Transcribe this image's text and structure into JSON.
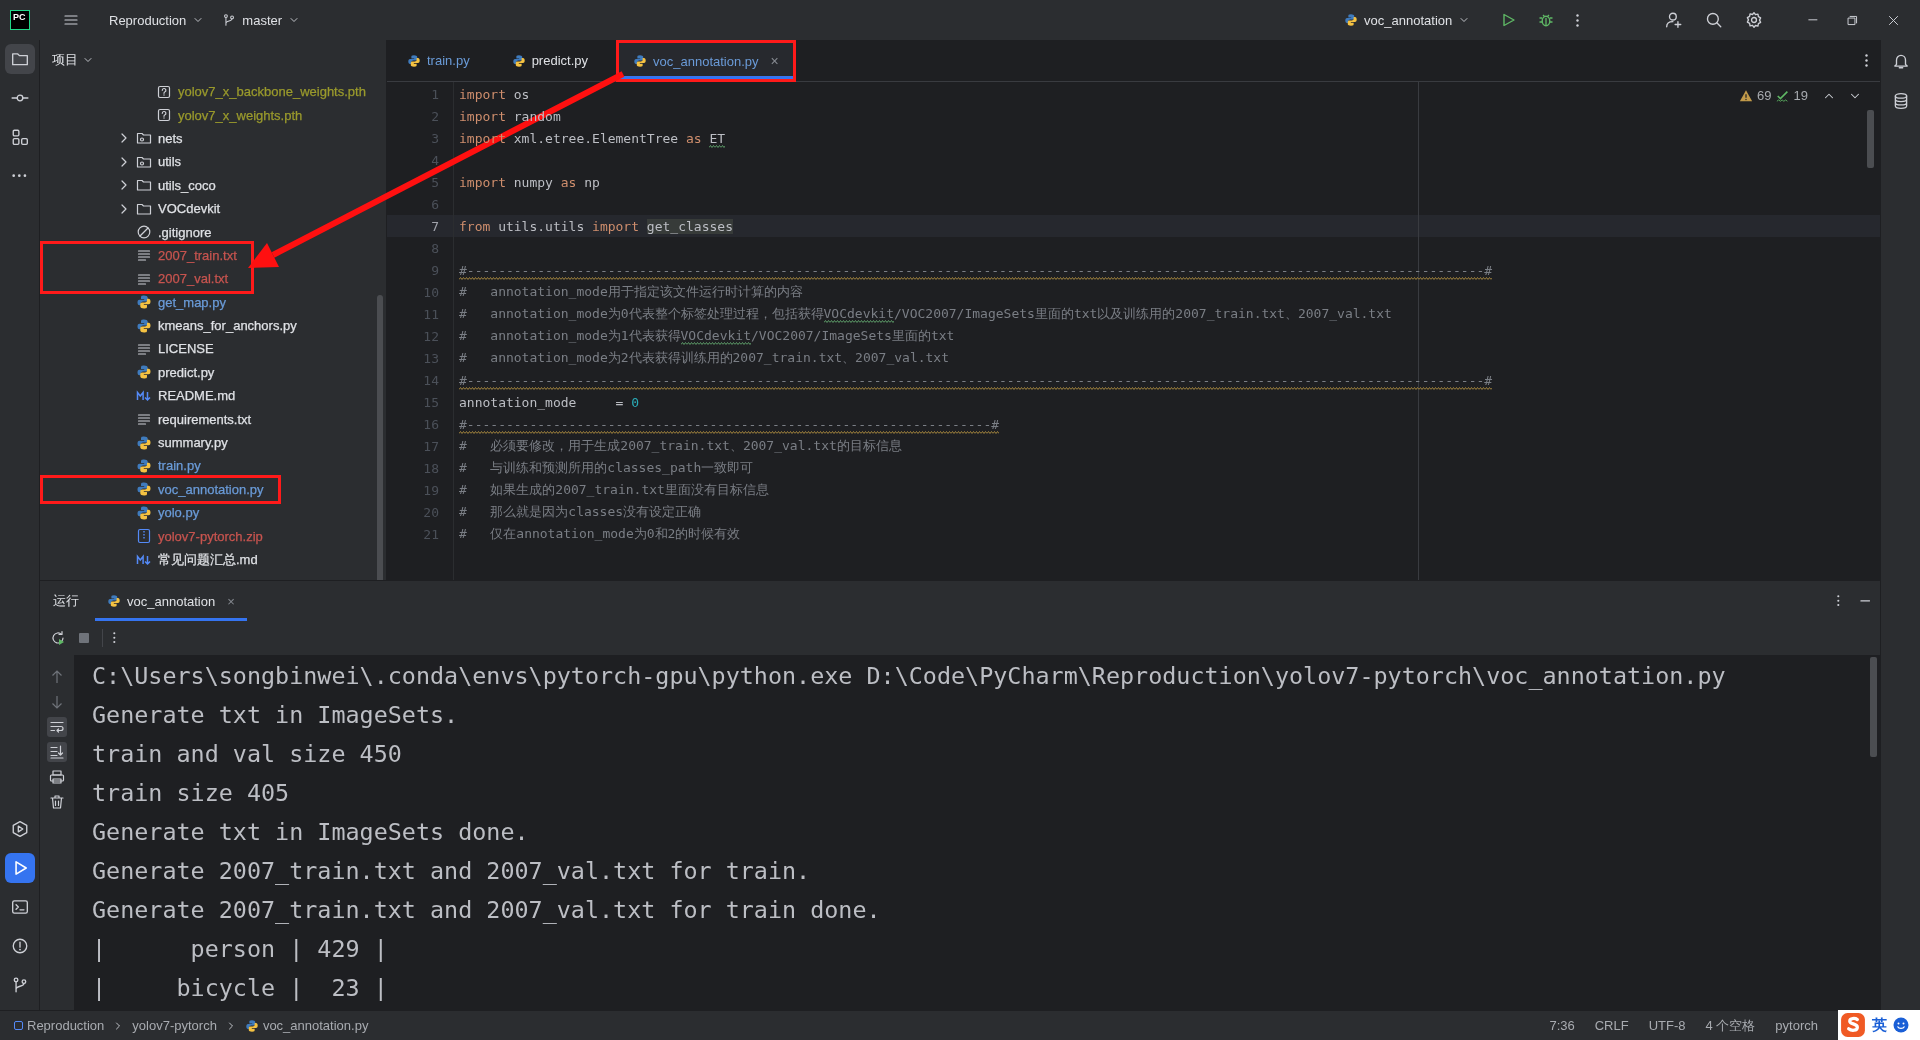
{
  "app_logo": "PC",
  "title_bar": {
    "project": "Reproduction",
    "branch": "master",
    "run_config": "voc_annotation"
  },
  "left_toolbar": {
    "top": [
      {
        "kind": "project",
        "selected": true
      },
      {
        "kind": "commit",
        "selected": false
      },
      {
        "kind": "structure",
        "selected": false
      },
      {
        "kind": "more",
        "selected": false
      }
    ],
    "bottom": [
      {
        "kind": "services",
        "selected": false
      },
      {
        "kind": "run",
        "selected": true
      },
      {
        "kind": "terminal",
        "selected": false
      },
      {
        "kind": "problems",
        "selected": false
      },
      {
        "kind": "git",
        "selected": false
      }
    ]
  },
  "project_panel": {
    "title": "项目",
    "partial_folder_children": [
      {
        "name": "yolov7_x_backbone_weights.pth",
        "kind": "unknown",
        "color": "#9a9a2c",
        "highlighted": false
      },
      {
        "name": "yolov7_x_weights.pth",
        "kind": "unknown",
        "color": "#9a9a2c",
        "highlighted": false
      }
    ],
    "items": [
      {
        "name": "nets",
        "kind": "package",
        "expanded": false,
        "color": "#dfe1e5",
        "highlighted": false
      },
      {
        "name": "utils",
        "kind": "package",
        "expanded": false,
        "color": "#dfe1e5",
        "highlighted": false
      },
      {
        "name": "utils_coco",
        "kind": "folder",
        "expanded": false,
        "color": "#dfe1e5",
        "highlighted": false
      },
      {
        "name": "VOCdevkit",
        "kind": "folder",
        "expanded": false,
        "color": "#dfe1e5",
        "highlighted": false
      },
      {
        "name": ".gitignore",
        "kind": "ignore",
        "color": "#dfe1e5",
        "highlighted": false
      },
      {
        "name": "2007_train.txt",
        "kind": "text",
        "color": "#c7544f",
        "highlighted": true
      },
      {
        "name": "2007_val.txt",
        "kind": "text",
        "color": "#c7544f",
        "highlighted": true
      },
      {
        "name": "get_map.py",
        "kind": "python",
        "color": "#6a9bd8",
        "highlighted": false
      },
      {
        "name": "kmeans_for_anchors.py",
        "kind": "python",
        "color": "#dfe1e5",
        "highlighted": false
      },
      {
        "name": "LICENSE",
        "kind": "text",
        "color": "#dfe1e5",
        "highlighted": false
      },
      {
        "name": "predict.py",
        "kind": "python",
        "color": "#dfe1e5",
        "highlighted": false
      },
      {
        "name": "README.md",
        "kind": "markdown",
        "color": "#dfe1e5",
        "highlighted": false
      },
      {
        "name": "requirements.txt",
        "kind": "text",
        "color": "#dfe1e5",
        "highlighted": false
      },
      {
        "name": "summary.py",
        "kind": "python",
        "color": "#dfe1e5",
        "highlighted": false
      },
      {
        "name": "train.py",
        "kind": "python",
        "color": "#6a9bd8",
        "highlighted": false
      },
      {
        "name": "voc_annotation.py",
        "kind": "python",
        "color": "#6a9bd8",
        "highlighted": true
      },
      {
        "name": "yolo.py",
        "kind": "python",
        "color": "#6a9bd8",
        "highlighted": false
      },
      {
        "name": "yolov7-pytorch.zip",
        "kind": "archive",
        "color": "#c7544f",
        "highlighted": false
      },
      {
        "name": "常见问题汇总.md",
        "kind": "markdown",
        "color": "#dfe1e5",
        "highlighted": false
      }
    ]
  },
  "editor": {
    "tabs": [
      {
        "label": "train.py",
        "selected": false,
        "color": "#6a9bd8",
        "highlighted": false
      },
      {
        "label": "predict.py",
        "selected": false,
        "color": "#dfe1e5",
        "highlighted": false
      },
      {
        "label": "voc_annotation.py",
        "selected": true,
        "color": "#6a9bd8",
        "highlighted": true,
        "close": "×"
      }
    ],
    "warnings": "69",
    "typos": "19",
    "lines": [
      {
        "number": "1",
        "current": false,
        "segments": [
          {
            "kind": "keyword",
            "text": "import"
          },
          {
            "kind": "plain",
            "text": " os"
          }
        ]
      },
      {
        "number": "2",
        "current": false,
        "segments": [
          {
            "kind": "keyword",
            "text": "import"
          },
          {
            "kind": "plain",
            "text": " random"
          }
        ]
      },
      {
        "number": "3",
        "current": false,
        "segments": [
          {
            "kind": "keyword",
            "text": "import"
          },
          {
            "kind": "plain",
            "text": " xml.etree.ElementTree "
          },
          {
            "kind": "keyword",
            "text": "as "
          },
          {
            "kind": "plain",
            "text": "ET",
            "typo_squiggle": true
          }
        ]
      },
      {
        "number": "4",
        "current": false
      },
      {
        "number": "5",
        "current": false,
        "segments": [
          {
            "kind": "keyword",
            "text": "import"
          },
          {
            "kind": "plain",
            "text": " numpy "
          },
          {
            "kind": "keyword",
            "text": "as"
          },
          {
            "kind": "plain",
            "text": " np"
          }
        ]
      },
      {
        "number": "6",
        "current": false
      },
      {
        "number": "7",
        "current": true,
        "segments": [
          {
            "kind": "keyword",
            "text": "from"
          },
          {
            "kind": "plain",
            "text": " utils.utils "
          },
          {
            "kind": "keyword",
            "text": "import "
          },
          {
            "kind": "usage",
            "text": "get_classes"
          }
        ]
      },
      {
        "number": "8",
        "current": false
      },
      {
        "number": "9",
        "current": false,
        "segments": [
          {
            "kind": "comment",
            "text": "#----------------------------------------------------------------------------------------------------------------------------------#",
            "warning_squiggle": true
          }
        ]
      },
      {
        "number": "10",
        "current": false,
        "segments": [
          {
            "kind": "comment",
            "text": "#   annotation_mode用于指定该文件运行时计算的内容"
          }
        ]
      },
      {
        "number": "11",
        "current": false,
        "segments": [
          {
            "kind": "comment",
            "text": "#   annotation_mode为0代表整个标签处理过程，包括获得"
          },
          {
            "kind": "comment",
            "text": "VOCdevkit",
            "typo_squiggle": true
          },
          {
            "kind": "comment",
            "text": "/VOC2007/ImageSets里面的txt以及训练用的2007_train.txt、2007_val.txt"
          }
        ]
      },
      {
        "number": "12",
        "current": false,
        "segments": [
          {
            "kind": "comment",
            "text": "#   annotation_mode为1代表获得"
          },
          {
            "kind": "comment",
            "text": "VOCdevkit",
            "typo_squiggle": true
          },
          {
            "kind": "comment",
            "text": "/VOC2007/ImageSets里面的txt"
          }
        ]
      },
      {
        "number": "13",
        "current": false,
        "segments": [
          {
            "kind": "comment",
            "text": "#   annotation_mode为2代表获得训练用的2007_train.txt、2007_val.txt"
          }
        ]
      },
      {
        "number": "14",
        "current": false,
        "segments": [
          {
            "kind": "comment",
            "text": "#----------------------------------------------------------------------------------------------------------------------------------#",
            "warning_squiggle": true
          }
        ]
      },
      {
        "number": "15",
        "current": false,
        "segments": [
          {
            "kind": "plain",
            "text": "annotation_mode     = "
          },
          {
            "kind": "number",
            "text": "0"
          }
        ]
      },
      {
        "number": "16",
        "current": false,
        "segments": [
          {
            "kind": "comment",
            "text": "#-------------------------------------------------------------------#",
            "warning_squiggle": true
          }
        ]
      },
      {
        "number": "17",
        "current": false,
        "segments": [
          {
            "kind": "comment",
            "text": "#   必须要修改，用于生成2007_train.txt、2007_val.txt的目标信息"
          }
        ]
      },
      {
        "number": "18",
        "current": false,
        "segments": [
          {
            "kind": "comment",
            "text": "#   与训练和预测所用的classes_path一致即可"
          }
        ]
      },
      {
        "number": "19",
        "current": false,
        "segments": [
          {
            "kind": "comment",
            "text": "#   如果生成的2007_train.txt里面没有目标信息"
          }
        ]
      },
      {
        "number": "20",
        "current": false,
        "segments": [
          {
            "kind": "comment",
            "text": "#   那么就是因为classes没有设定正确"
          }
        ]
      },
      {
        "number": "21",
        "current": false,
        "segments": [
          {
            "kind": "comment",
            "text": "#   仅在annotation_mode为0和2的时候有效"
          }
        ]
      }
    ]
  },
  "run_panel": {
    "title": "运行",
    "tabs": [
      {
        "label": "voc_annotation",
        "selected": true,
        "close": "×"
      }
    ],
    "console_tools": [
      {
        "kind": "up",
        "on": false
      },
      {
        "kind": "down",
        "on": false
      },
      {
        "kind": "wrap",
        "on": true
      },
      {
        "kind": "scroll-end",
        "on": true
      },
      {
        "kind": "print",
        "on": false
      },
      {
        "kind": "trash",
        "on": false
      }
    ],
    "console": [
      "C:\\Users\\songbinwei\\.conda\\envs\\pytorch-gpu\\python.exe D:\\Code\\PyCharm\\Reproduction\\yolov7-pytorch\\voc_annotation.py",
      "Generate txt in ImageSets.",
      "train and val size 450",
      "train size 405",
      "Generate txt in ImageSets done.",
      "Generate 2007_train.txt and 2007_val.txt for train.",
      "Generate 2007_train.txt and 2007_val.txt for train done.",
      "|      person | 429 |",
      "|     bicycle |  23 |"
    ]
  },
  "status_bar": {
    "breadcrumbs": [
      "Reproduction",
      "yolov7-pytorch",
      "voc_annotation.py"
    ],
    "items": [
      "7:36",
      "CRLF",
      "UTF-8",
      "4 个空格",
      "pytorch"
    ]
  },
  "ime": {
    "label": "英"
  },
  "annotation_arrow": true
}
